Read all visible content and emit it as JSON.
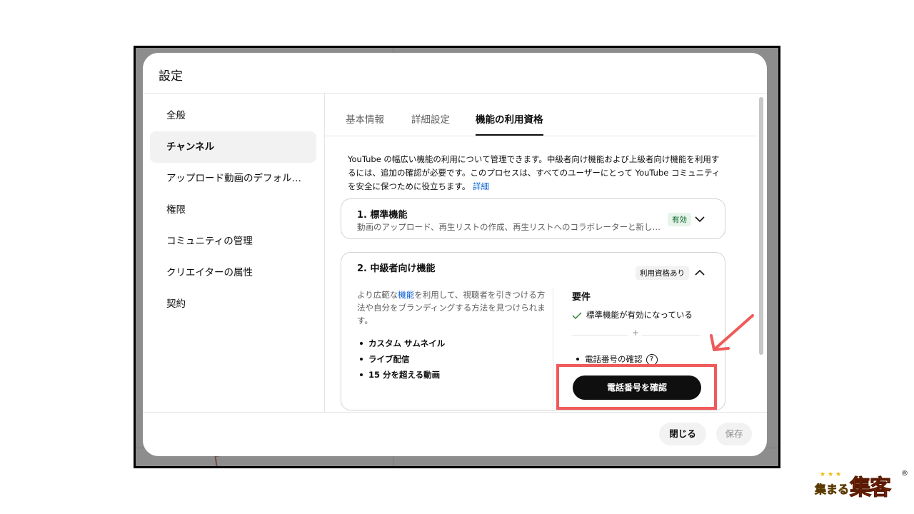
{
  "dialog": {
    "title": "設定"
  },
  "sidebar": {
    "items": [
      {
        "label": "全般",
        "active": false
      },
      {
        "label": "チャンネル",
        "active": true
      },
      {
        "label": "アップロード動画のデフォル…",
        "active": false
      },
      {
        "label": "権限",
        "active": false
      },
      {
        "label": "コミュニティの管理",
        "active": false
      },
      {
        "label": "クリエイターの属性",
        "active": false
      },
      {
        "label": "契約",
        "active": false
      }
    ]
  },
  "tabs": [
    {
      "label": "基本情報",
      "active": false
    },
    {
      "label": "詳細設定",
      "active": false
    },
    {
      "label": "機能の利用資格",
      "active": true
    }
  ],
  "intro": {
    "text": "YouTube の幅広い機能の利用について管理できます。中級者向け機能および上級者向け機能を利用するには、追加の確認が必要です。このプロセスは、すべてのユーザーにとって YouTube コミュニティを安全に保つために役立ちます。",
    "link": "詳細"
  },
  "card_standard": {
    "title": "1. 標準機能",
    "subtitle": "動画のアップロード、再生リストの作成、再生リストへのコラボレーターと新し…",
    "badge": "有効"
  },
  "card_intermediate": {
    "title": "2. 中級者向け機能",
    "badge": "利用資格あり",
    "desc_before": "より広範な",
    "desc_link": "機能",
    "desc_after": "を利用して、視聴者を引きつける方法や自分をブランディングする方法を見つけられます。",
    "features": [
      "カスタム サムネイル",
      "ライブ配信",
      "15 分を超える動画"
    ],
    "requirements_title": "要件",
    "req_done": "標準機能が有効になっている",
    "plus": "+",
    "req_phone": "電話番号の確認",
    "help": "?",
    "verify_button": "電話番号を確認"
  },
  "footer": {
    "close": "閉じる",
    "save": "保存"
  },
  "watermark": {
    "small": "集まる",
    "big": "集客",
    "stars": "★★★",
    "reg": "®"
  },
  "colors": {
    "link": "#065fd4",
    "highlight": "#ef5a5a",
    "badge_green_bg": "#e6f4ea"
  },
  "icons": {
    "card1_toggle": "chevron-down-icon",
    "card2_toggle": "chevron-up-icon",
    "req_done": "check-icon",
    "help": "help-circle-icon"
  }
}
